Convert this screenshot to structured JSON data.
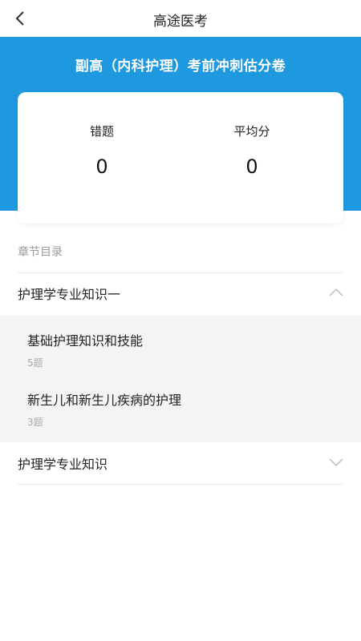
{
  "nav": {
    "title": "高途医考",
    "back_icon": "chevron-left-icon"
  },
  "banner": {
    "exam_title": "副高（内科护理）考前冲刺估分卷",
    "color": "#1e98de"
  },
  "stats": {
    "wrong": {
      "label": "错题",
      "value": "0"
    },
    "average": {
      "label": "平均分",
      "value": "0"
    }
  },
  "section": {
    "label": "章节目录"
  },
  "chapters": [
    {
      "name": "护理学专业知识一",
      "expanded": true,
      "icon": "chevron-up-icon",
      "items": [
        {
          "name": "基础护理知识和技能",
          "count": "5题"
        },
        {
          "name": "新生儿和新生儿疾病的护理",
          "count": "3题"
        }
      ]
    },
    {
      "name": "护理学专业知识",
      "expanded": false,
      "icon": "chevron-down-icon"
    }
  ]
}
